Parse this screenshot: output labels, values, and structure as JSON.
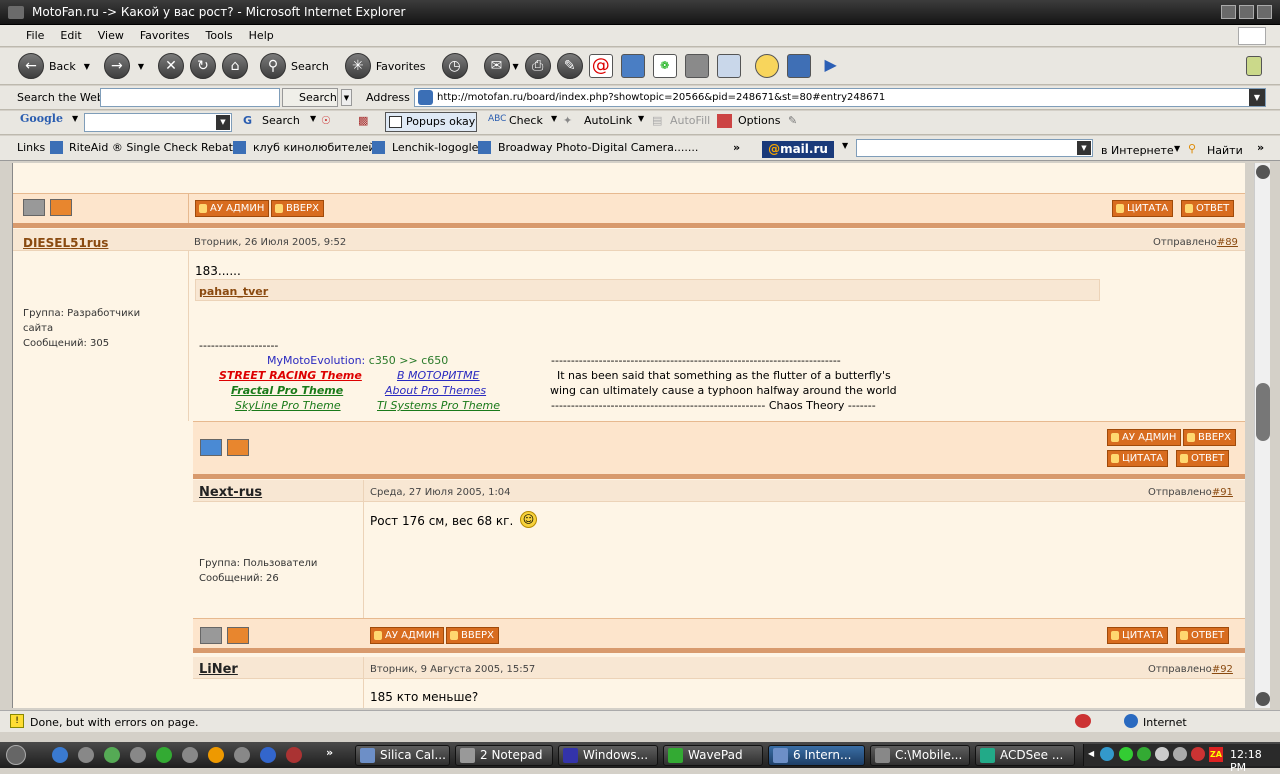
{
  "window": {
    "title": "MotoFan.ru -> Какой у вас рост? - Microsoft Internet Explorer"
  },
  "menu": [
    "File",
    "Edit",
    "View",
    "Favorites",
    "Tools",
    "Help"
  ],
  "toolbar": {
    "back": "Back",
    "search": "Search",
    "favorites": "Favorites"
  },
  "searchbar": {
    "label": "Search the Web",
    "button": "Search",
    "address_label": "Address",
    "url": "http://motofan.ru/board/index.php?showtopic=20566&pid=248671&st=80#entry248671"
  },
  "googlebar": {
    "logo": "Google",
    "search": "Search",
    "popups": "Popups okay",
    "check": "Check",
    "autolink": "AutoLink",
    "autofill": "AutoFill",
    "options": "Options"
  },
  "links": {
    "label": "Links",
    "items": [
      "RiteAid ® Single Check Rebates",
      "клуб кинолюбителей",
      "Lenchik-logogle",
      "Broadway Photo-Digital Camera......."
    ],
    "mailru_at": "@",
    "mailru_name": "mail.ru",
    "scope": "в Интернете",
    "find": "Найти"
  },
  "buttons": {
    "admin": "АУ АДМИН",
    "top": "ВВЕРХ",
    "quote": "ЦИТАТА",
    "reply": "ОТВЕТ"
  },
  "posts": [
    {
      "user": "DIESEL51rus",
      "date": "Вторник, 26 Июля 2005, 9:52",
      "sent": "Отправлено",
      "num": "#89",
      "group": "Группа: Разработчики сайта",
      "count": "Сообщений: 305",
      "text": "183......"
    },
    {
      "user": "Next-rus",
      "date": "Среда, 27 Июля 2005, 1:04",
      "sent": "Отправлено",
      "num": "#91",
      "group": "Группа: Пользователи",
      "count": "Сообщений: 26",
      "text": "Рост 176 см, вес 68 кг."
    },
    {
      "user": "LiNer",
      "date": "Вторник, 9 Августа 2005, 15:57",
      "sent": "Отправлено",
      "num": "#92",
      "text": "185 кто меньше?"
    }
  ],
  "quote": {
    "user": "pahan_tver",
    "dashes": "--------------------",
    "evo_a": "MyMoto",
    "evo_b": "Evolution:",
    "evo_c": "c350 >> c650",
    "links": [
      "STREET RACING Theme",
      "В МОТОРИТМЕ",
      "Fractal Pro Theme",
      "About Pro Themes",
      "SkyLine Pro Theme",
      "TI Systems Pro Theme"
    ],
    "chaos1": "-------------------------------------------------------------------------",
    "chaos2": "It nas been said that something as the flutter of a butterfly's",
    "chaos3": "wing can ultimately cause a typhoon halfway around the world",
    "chaos4": "------------------------------------------------------ Chaos Theory -------"
  },
  "status": {
    "text": "Done, but with errors on page.",
    "zone": "Internet"
  },
  "taskbar": {
    "tasks": [
      "Silica Cal...",
      "2 Notepad",
      "Windows...",
      "WavePad",
      "6 Intern...",
      "C:\\Mobile...",
      "ACDSee ..."
    ],
    "clock": "12:18 PM"
  }
}
